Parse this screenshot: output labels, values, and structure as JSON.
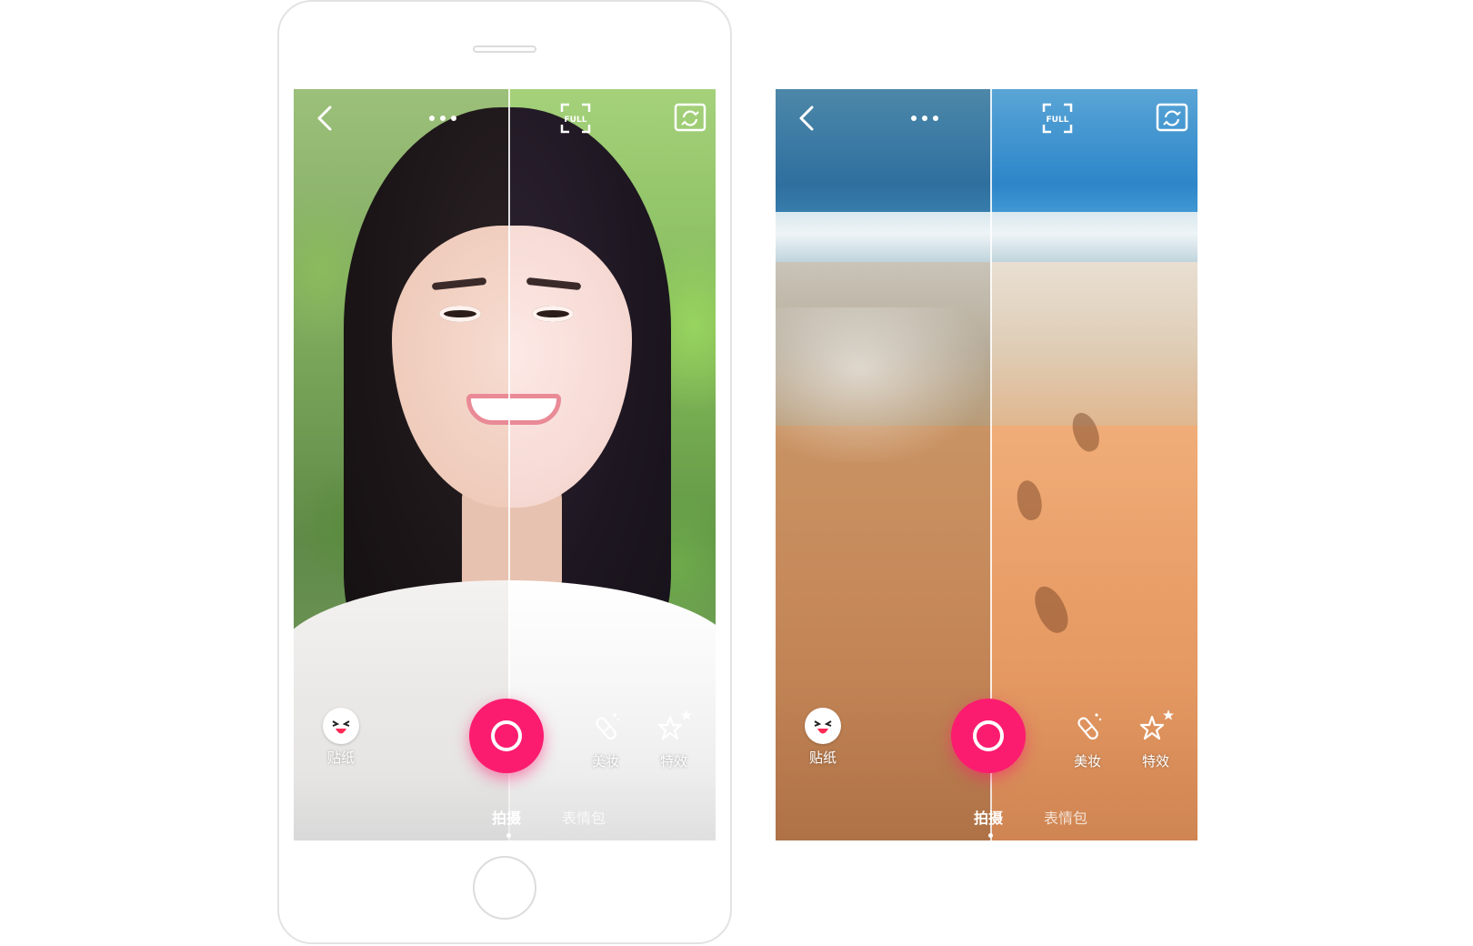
{
  "screens": [
    {
      "id": "portrait",
      "top_icons": [
        "back-icon",
        "more-icon",
        "full-icon",
        "camera-switch-icon"
      ],
      "full_label": "FULL",
      "tools": {
        "sticker": {
          "label": "贴纸",
          "icon": "sticker-face-icon"
        },
        "makeup": {
          "label": "美妆",
          "icon": "makeup-brush-icon"
        },
        "effects": {
          "label": "特效",
          "icon": "star-effects-icon"
        }
      },
      "modes": {
        "photo": "拍摄",
        "meme": "表情包",
        "active": "拍摄"
      }
    },
    {
      "id": "beach",
      "top_icons": [
        "back-icon",
        "more-icon",
        "full-icon",
        "camera-switch-icon"
      ],
      "full_label": "FULL",
      "tools": {
        "sticker": {
          "label": "贴纸",
          "icon": "sticker-face-icon"
        },
        "makeup": {
          "label": "美妆",
          "icon": "makeup-brush-icon"
        },
        "effects": {
          "label": "特效",
          "icon": "star-effects-icon"
        }
      },
      "modes": {
        "photo": "拍摄",
        "meme": "表情包",
        "active": "拍摄"
      }
    }
  ],
  "colors": {
    "shutter": "#fb1c6f",
    "frame_border": "#e3e3e3",
    "icon": "#ffffff"
  }
}
